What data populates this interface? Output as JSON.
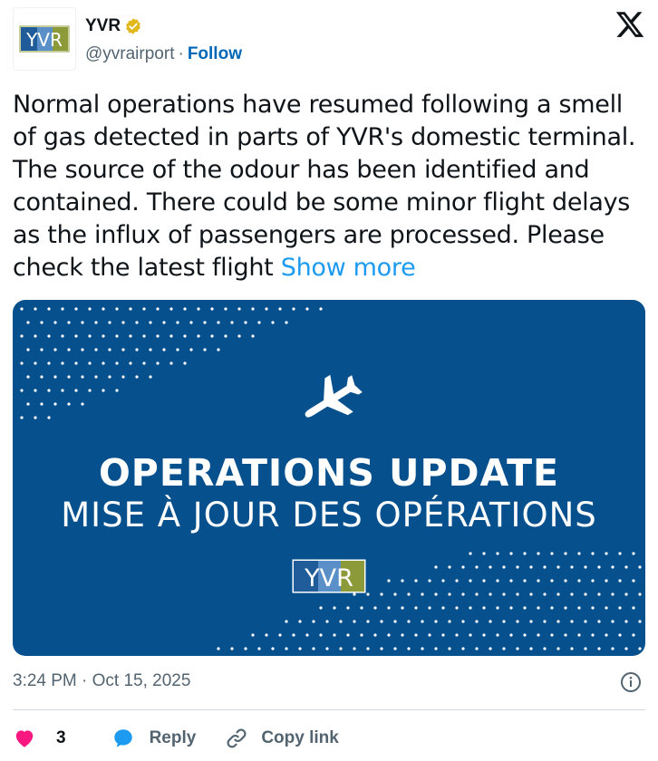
{
  "account": {
    "name": "YVR",
    "handle": "@yvrairport",
    "separator": "·",
    "follow_label": "Follow",
    "logo_text": "YVR",
    "verified_color": "#e2b719"
  },
  "tweet": {
    "text": "Normal operations have resumed following a smell of gas detected in parts of YVR's domestic terminal. The source of the odour has been identified and contained. There could be some minor flight delays as the influx of passengers are processed. Please check the latest flight ",
    "show_more_label": "Show more",
    "timestamp": "3:24 PM · Oct 15, 2025"
  },
  "media": {
    "title": "OPERATIONS UPDATE",
    "subtitle": "MISE À JOUR DES OPÉRATIONS",
    "logo_text": "YVR",
    "background": "#07508e"
  },
  "actions": {
    "like_count": "3",
    "reply_label": "Reply",
    "copy_label": "Copy link"
  },
  "icons": {
    "verified": "verified-badge-icon",
    "x_logo": "x-logo-icon",
    "plane": "airplane-icon",
    "info": "info-icon",
    "like": "heart-icon",
    "reply": "speech-bubble-icon",
    "copy": "link-icon"
  }
}
